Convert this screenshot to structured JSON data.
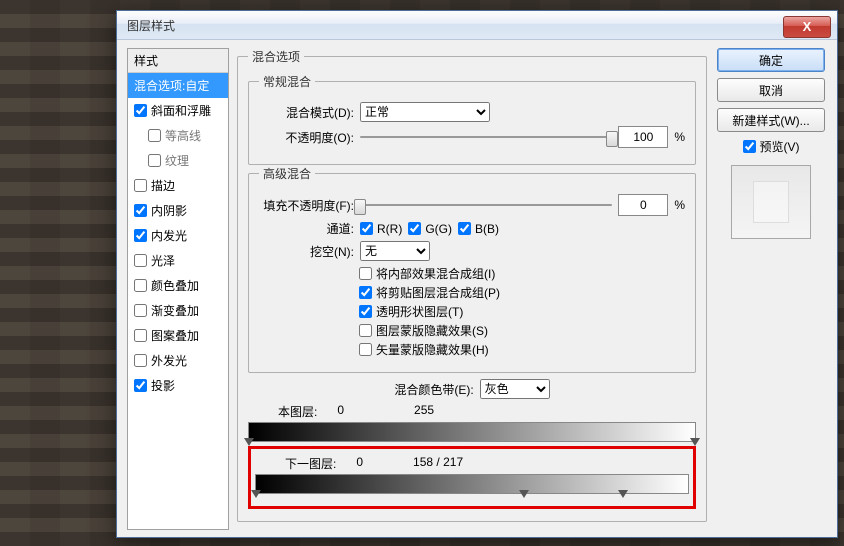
{
  "title": "图层样式",
  "styles": {
    "header": "样式",
    "items": [
      {
        "label": "混合选项:自定",
        "sel": true,
        "checkbox": false,
        "checked": false,
        "indent": 0
      },
      {
        "label": "斜面和浮雕",
        "sel": false,
        "checkbox": true,
        "checked": true,
        "indent": 0
      },
      {
        "label": "等高线",
        "sel": false,
        "checkbox": true,
        "checked": false,
        "indent": 1
      },
      {
        "label": "纹理",
        "sel": false,
        "checkbox": true,
        "checked": false,
        "indent": 1
      },
      {
        "label": "描边",
        "sel": false,
        "checkbox": true,
        "checked": false,
        "indent": 0
      },
      {
        "label": "内阴影",
        "sel": false,
        "checkbox": true,
        "checked": true,
        "indent": 0
      },
      {
        "label": "内发光",
        "sel": false,
        "checkbox": true,
        "checked": true,
        "indent": 0
      },
      {
        "label": "光泽",
        "sel": false,
        "checkbox": true,
        "checked": false,
        "indent": 0
      },
      {
        "label": "颜色叠加",
        "sel": false,
        "checkbox": true,
        "checked": false,
        "indent": 0
      },
      {
        "label": "渐变叠加",
        "sel": false,
        "checkbox": true,
        "checked": false,
        "indent": 0
      },
      {
        "label": "图案叠加",
        "sel": false,
        "checkbox": true,
        "checked": false,
        "indent": 0
      },
      {
        "label": "外发光",
        "sel": false,
        "checkbox": true,
        "checked": false,
        "indent": 0
      },
      {
        "label": "投影",
        "sel": false,
        "checkbox": true,
        "checked": true,
        "indent": 0
      }
    ]
  },
  "blend": {
    "legend": "混合选项",
    "general": {
      "legend": "常规混合",
      "modeLabel": "混合模式(D):",
      "mode": "正常",
      "opacityLabel": "不透明度(O):",
      "opacity": "100",
      "pct": "%"
    },
    "adv": {
      "legend": "高级混合",
      "fillLabel": "填充不透明度(F):",
      "fill": "0",
      "pct": "%",
      "channelLabel": "通道:",
      "r": "R(R)",
      "g": "G(G)",
      "b": "B(B)",
      "knockoutLabel": "挖空(N):",
      "knockout": "无",
      "opts": [
        "将内部效果混合成组(I)",
        "将剪贴图层混合成组(P)",
        "透明形状图层(T)",
        "图层蒙版隐藏效果(S)",
        "矢量蒙版隐藏效果(H)"
      ],
      "checked": [
        false,
        true,
        true,
        false,
        false
      ]
    },
    "colorBand": {
      "label": "混合颜色带(E):",
      "value": "灰色",
      "this": {
        "label": "本图层:",
        "lo": "0",
        "hi": "255"
      },
      "next": {
        "label": "下一图层:",
        "lo": "0",
        "mid": "158",
        "sep": "/",
        "hi": "217"
      }
    }
  },
  "buttons": {
    "ok": "确定",
    "cancel": "取消",
    "newstyle": "新建样式(W)...",
    "previewChk": "预览(V)"
  }
}
